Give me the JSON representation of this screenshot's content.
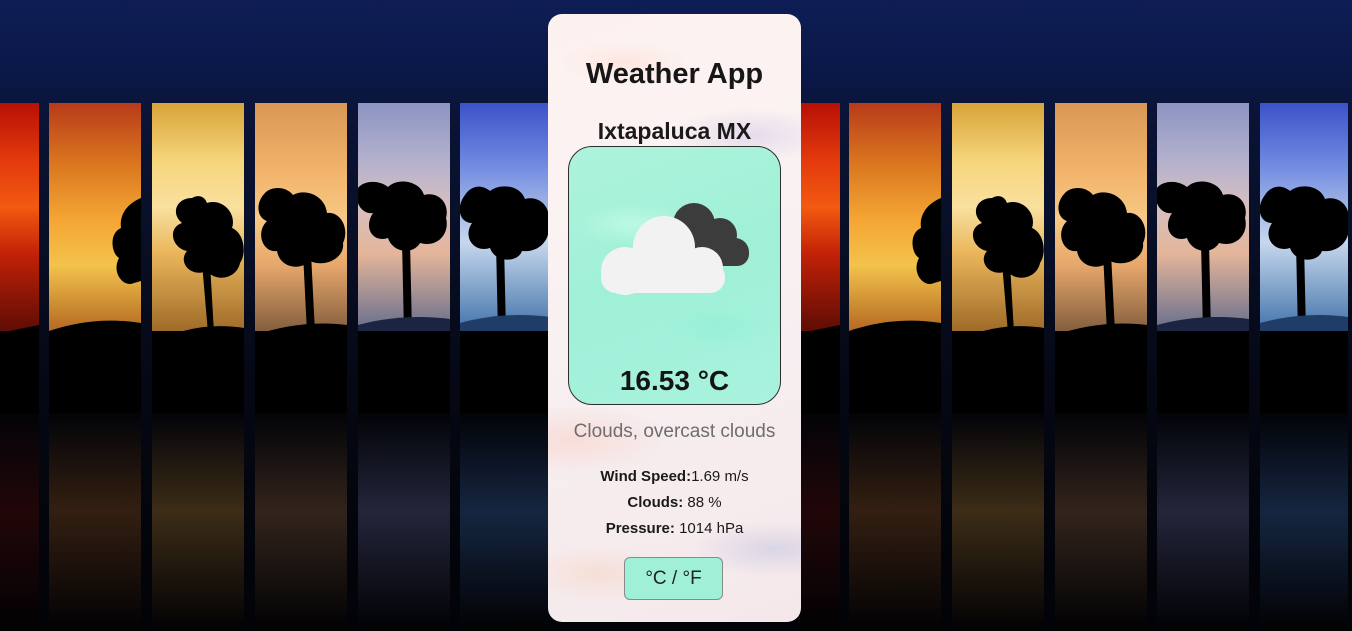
{
  "app": {
    "title": "Weather App",
    "location": "Ixtapaluca MX",
    "icon": "cloud-icon",
    "temperature": "16.53 °C",
    "description": "Clouds, overcast clouds",
    "stats": [
      {
        "label": "Wind Speed:",
        "value": "1.69 m/s"
      },
      {
        "label": "Clouds:",
        "value": " 88 %"
      },
      {
        "label": "Pressure:",
        "value": " 1014 hPa"
      }
    ],
    "unit_toggle_label": "°C / °F"
  },
  "colors": {
    "panel_accent": "#9ff0d7",
    "background_top": "#0e1d55",
    "text_dark": "#161616",
    "text_muted": "#6e6e6e",
    "cloud_light": "#f2f2f2",
    "cloud_dark": "#3c3c3c"
  }
}
